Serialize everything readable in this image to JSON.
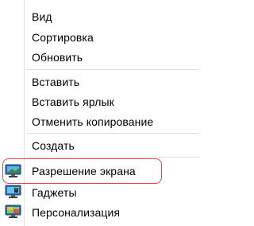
{
  "context_menu": {
    "items": [
      {
        "label": "Вид"
      },
      {
        "label": "Сортировка"
      },
      {
        "label": "Обновить"
      },
      {
        "label": "Вставить"
      },
      {
        "label": "Вставить ярлык"
      },
      {
        "label": "Отменить копирование"
      },
      {
        "label": "Создать"
      },
      {
        "label": "Разрешение экрана",
        "icon": "display-settings-icon"
      },
      {
        "label": "Гаджеты",
        "icon": "gadgets-icon"
      },
      {
        "label": "Персонализация",
        "icon": "personalization-icon"
      }
    ],
    "highlight_color": "#e8414b"
  }
}
